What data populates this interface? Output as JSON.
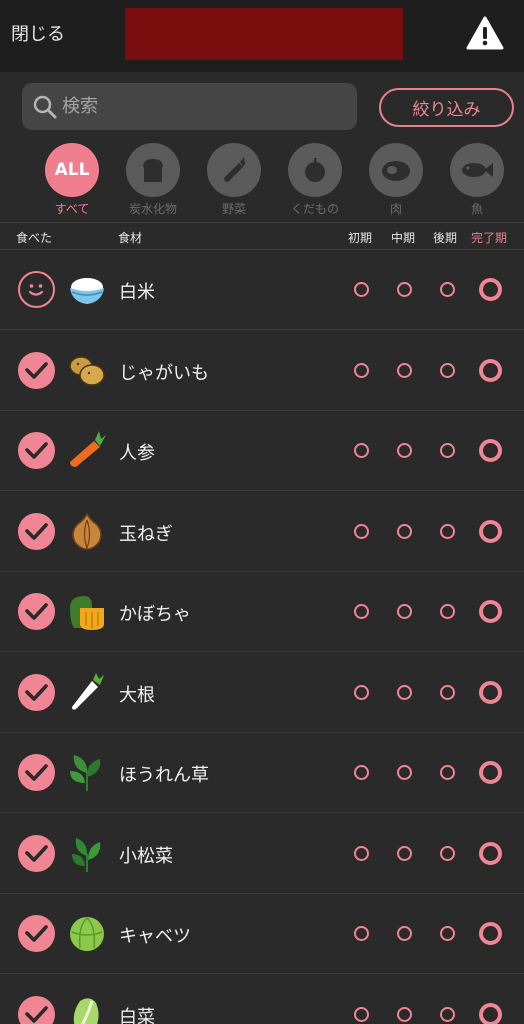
{
  "topbar": {
    "close_label": "閉じる",
    "warning_icon": "warning-triangle-icon"
  },
  "search": {
    "placeholder": "検索",
    "icon": "search-icon"
  },
  "filter": {
    "label": "絞り込み"
  },
  "categories": [
    {
      "label": "すべて",
      "badge": "ALL",
      "icon": "all-badge",
      "active": true
    },
    {
      "label": "炭水化物",
      "icon": "bread-icon",
      "active": false
    },
    {
      "label": "野菜",
      "icon": "carrot-icon",
      "active": false
    },
    {
      "label": "くだもの",
      "icon": "apple-icon",
      "active": false
    },
    {
      "label": "肉",
      "icon": "meat-icon",
      "active": false
    },
    {
      "label": "魚",
      "icon": "fish-icon",
      "active": false
    }
  ],
  "columns": {
    "eaten": "食べた",
    "food": "食材",
    "early": "初期",
    "middle": "中期",
    "late": "後期",
    "complete": "完了期"
  },
  "foods": [
    {
      "name": "白米",
      "icon": "rice-bowl-icon",
      "eaten": false
    },
    {
      "name": "じゃがいも",
      "icon": "potato-icon",
      "eaten": true
    },
    {
      "name": "人参",
      "icon": "carrot-icon",
      "eaten": true
    },
    {
      "name": "玉ねぎ",
      "icon": "onion-icon",
      "eaten": true
    },
    {
      "name": "かぼちゃ",
      "icon": "pumpkin-icon",
      "eaten": true
    },
    {
      "name": "大根",
      "icon": "daikon-icon",
      "eaten": true
    },
    {
      "name": "ほうれん草",
      "icon": "spinach-icon",
      "eaten": true
    },
    {
      "name": "小松菜",
      "icon": "komatsuna-icon",
      "eaten": true
    },
    {
      "name": "キャベツ",
      "icon": "cabbage-icon",
      "eaten": true
    },
    {
      "name": "白菜",
      "icon": "chinese-cabbage-icon",
      "eaten": true
    }
  ],
  "colors": {
    "accent": "#f08594",
    "background": "#2b2a2b",
    "topbar": "#1e1e1e",
    "title_bar": "#7a0e0e"
  }
}
